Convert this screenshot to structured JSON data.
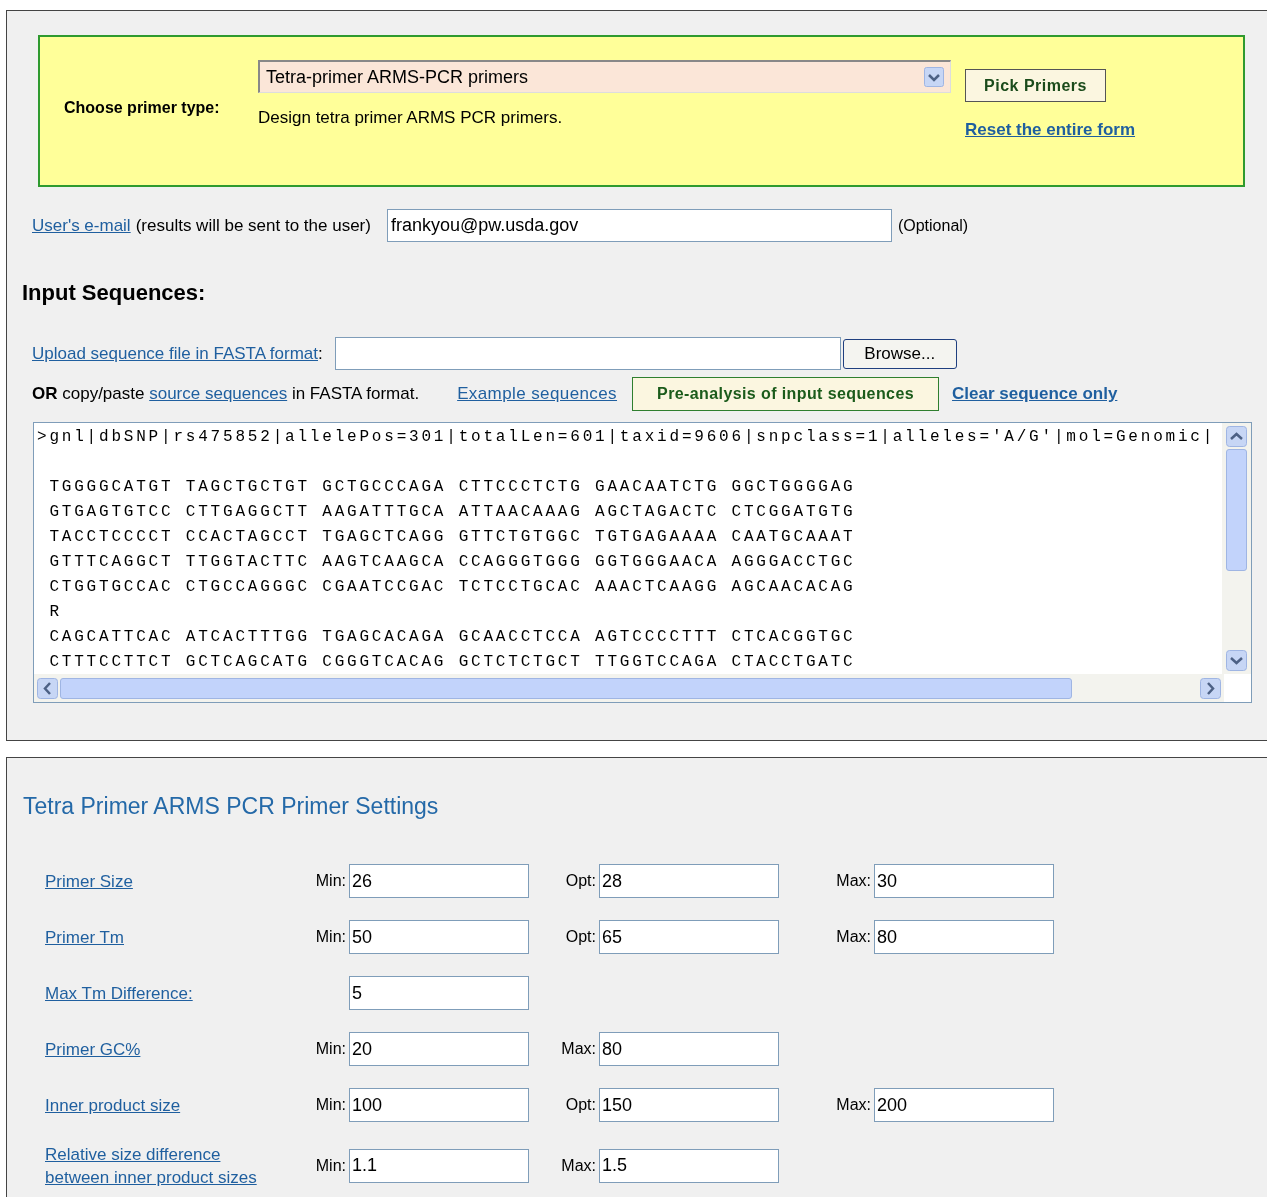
{
  "primer_type": {
    "label": "Choose primer type:",
    "selected_option": "Tetra-primer ARMS-PCR primers",
    "description": "Design tetra primer ARMS PCR primers.",
    "pick_button": "Pick Primers",
    "reset_link": "Reset the entire form"
  },
  "email": {
    "link": "User's e-mail",
    "note": "(results will be sent to the user)",
    "value": "frankyou@pw.usda.gov",
    "optional": "(Optional)"
  },
  "input_sequences": {
    "heading": "Input Sequences:",
    "upload_link": "Upload sequence file in FASTA format",
    "upload_colon": ":",
    "browse_button": "Browse...",
    "paste_text": "**OR** copy/paste",
    "source_link": "source sequences",
    "paste_suffix": "in FASTA format.",
    "example_link": "Example sequences",
    "preanalysis_button": "Pre-analysis of input sequences",
    "clear_link": "Clear sequence only",
    "sequence_header": ">gnl|dbSNP|rs475852|allelePos=301|totalLen=601|taxid=9606|snpclass=1|alleles='A/G'|mol=Genomic|",
    "sequence_lines": [
      " TGGGGCATGT TAGCTGCTGT GCTGCCCAGA CTTCCCTCTG GAACAATCTG GGCTGGGGAG",
      " GTGAGTGTCC CTTGAGGCTT AAGATTTGCA ATTAACAAAG AGCTAGACTC CTCGGATGTG",
      " TACCTCCCCT CCACTAGCCT TGAGCTCAGG GTTCTGTGGC TGTGAGAAAA CAATGCAAAT",
      " GTTTCAGGCT TTGGTACTTC AAGTCAAGCA CCAGGGTGGG GGTGGGAACA AGGGACCTGC",
      " CTGGTGCCAC CTGCCAGGGC CGAATCCGAC TCTCCTGCAC AAACTCAAGG AGCAACACAG",
      " R",
      " CAGCATTCAC ATCACTTTGG TGAGCACAGA GCAACCTCCA AGTCCCCTTT CTCACGGTGC",
      " CTTTCCTTCT GCTCAGCATG CGGGTCACAG GCTCTCTGCT TTGGTCCAGA CTACCTGATC"
    ]
  },
  "settings": {
    "title": "Tetra Primer ARMS PCR Primer Settings",
    "rows": [
      {
        "label": "Primer Size",
        "fields": [
          {
            "label": "Min:",
            "value": "26"
          },
          {
            "label": "Opt:",
            "value": "28"
          },
          {
            "label": "Max:",
            "value": "30"
          }
        ]
      },
      {
        "label": "Primer Tm",
        "fields": [
          {
            "label": "Min:",
            "value": "50"
          },
          {
            "label": "Opt:",
            "value": "65"
          },
          {
            "label": "Max:",
            "value": "80"
          }
        ]
      },
      {
        "label": "Max Tm Difference:",
        "fields": [
          {
            "value": "5"
          }
        ]
      },
      {
        "label": "Primer GC%",
        "fields": [
          {
            "label": "Min:",
            "value": "20"
          },
          {
            "label": "Max:",
            "value": "80"
          }
        ]
      },
      {
        "label": "Inner product size",
        "fields": [
          {
            "label": "Min:",
            "value": "100"
          },
          {
            "label": "Opt:",
            "value": "150"
          },
          {
            "label": "Max:",
            "value": "200"
          }
        ]
      },
      {
        "label": "Relative size difference between inner product sizes",
        "fields": [
          {
            "label": "Min:",
            "value": "1.1"
          },
          {
            "label": "Max:",
            "value": "1.5"
          }
        ]
      }
    ]
  }
}
